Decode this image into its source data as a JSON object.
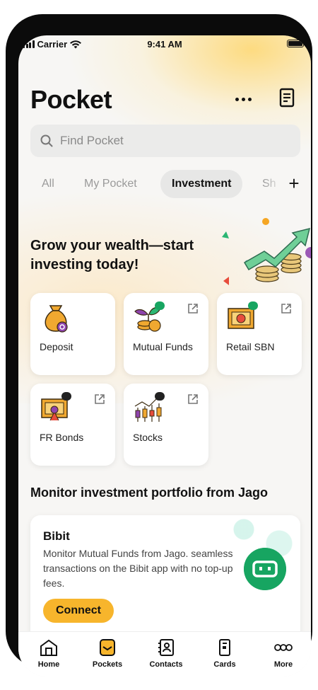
{
  "status_bar": {
    "carrier": "Carrier",
    "time": "9:41 AM"
  },
  "header": {
    "title": "Pocket",
    "more_icon": "more-dots-icon",
    "statement_icon": "document-icon"
  },
  "search": {
    "placeholder": "Find Pocket",
    "value": ""
  },
  "tabs": [
    {
      "label": "All",
      "active": false
    },
    {
      "label": "My Pocket",
      "active": false
    },
    {
      "label": "Investment",
      "active": true
    },
    {
      "label": "Sh",
      "active": false
    }
  ],
  "promo": {
    "text": "Grow your wealth—start investing today!"
  },
  "products": [
    {
      "label": "Deposit",
      "icon": "money-bag-icon",
      "external": false
    },
    {
      "label": "Mutual Funds",
      "icon": "plant-coins-icon",
      "external": true
    },
    {
      "label": "Retail SBN",
      "icon": "certificate-icon",
      "external": true
    },
    {
      "label": "FR Bonds",
      "icon": "bond-certificate-icon",
      "external": true
    },
    {
      "label": "Stocks",
      "icon": "candlestick-icon",
      "external": true
    }
  ],
  "portfolio": {
    "section_title": "Monitor investment portfolio from Jago",
    "bibit": {
      "title": "Bibit",
      "description": "Monitor Mutual Funds from Jago. seamless transactions on the Bibit app with no top-up fees.",
      "button": "Connect"
    }
  },
  "nav": [
    {
      "label": "Home",
      "icon": "home-icon"
    },
    {
      "label": "Pockets",
      "icon": "pocket-icon"
    },
    {
      "label": "Contacts",
      "icon": "contacts-icon"
    },
    {
      "label": "Cards",
      "icon": "card-icon"
    },
    {
      "label": "More",
      "icon": "more-circles-icon"
    }
  ],
  "colors": {
    "accent": "#f7b52c",
    "bibit_green": "#17a561",
    "background": "#f7f6f4"
  }
}
